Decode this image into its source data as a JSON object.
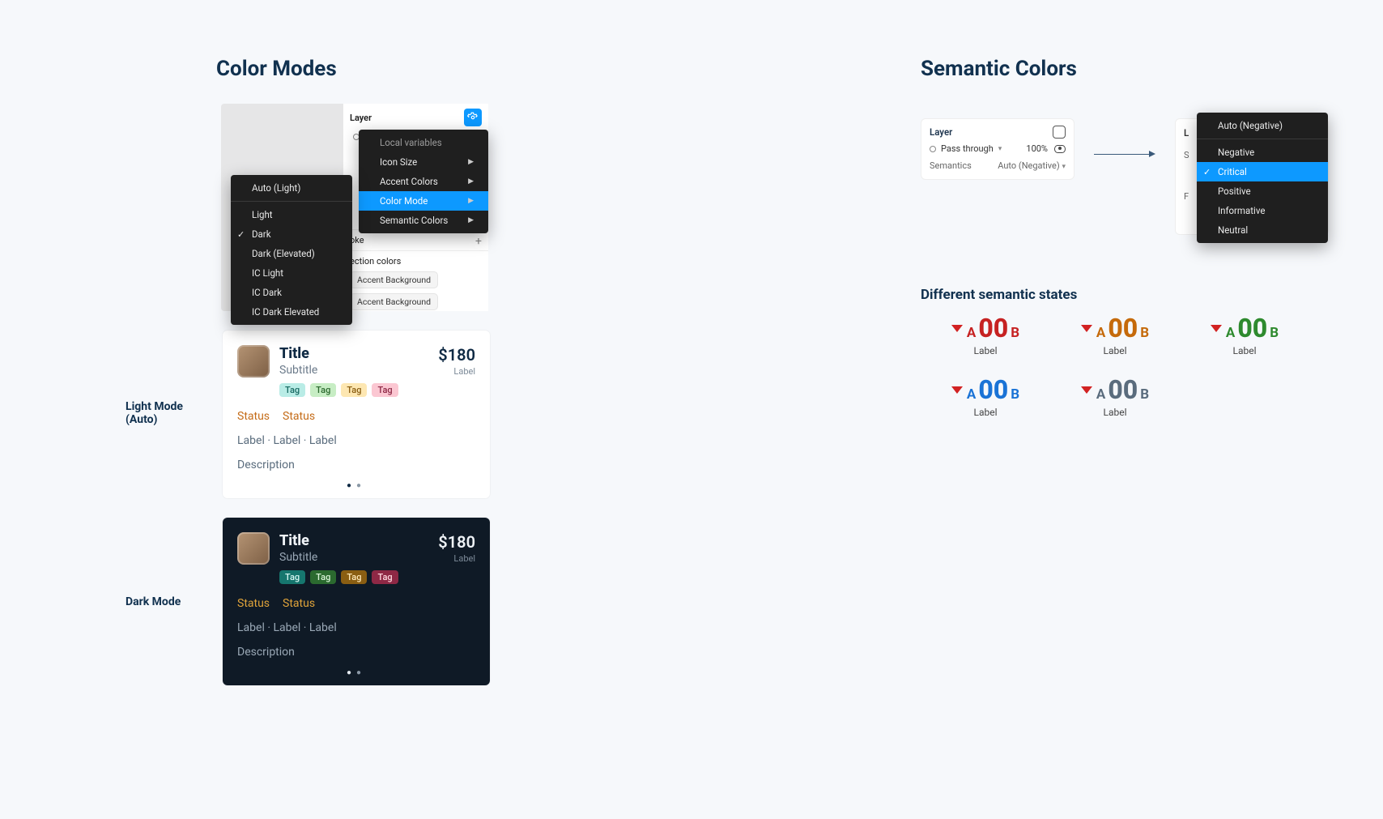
{
  "left": {
    "heading": "Color Modes",
    "figma": {
      "layerLabel": "Layer",
      "passthrough": "C",
      "strokeHeader": "oke",
      "selectionColorsHeader": "ection colors",
      "chip1": "Accent Background",
      "chip2": "Accent Background",
      "varsMenu": {
        "header": "Local variables",
        "items": [
          "Icon Size",
          "Accent Colors",
          "Color Mode",
          "Semantic Colors"
        ],
        "selectedIndex": 2
      },
      "modeMenu": {
        "auto": "Auto (Light)",
        "items": [
          "Light",
          "Dark",
          "Dark (Elevated)",
          "IC Light",
          "IC Dark",
          "IC Dark Elevated"
        ],
        "checkedIndex": 1
      }
    },
    "lightLabelA": "Light Mode",
    "lightLabelB": "(Auto)",
    "darkLabel": "Dark Mode",
    "card": {
      "title": "Title",
      "subtitle": "Subtitle",
      "price": "$180",
      "priceLabel": "Label",
      "tags": [
        "Tag",
        "Tag",
        "Tag",
        "Tag"
      ],
      "status1": "Status",
      "status2": "Status",
      "labelsLine": "Label · Label · Label",
      "description": "Description"
    }
  },
  "right": {
    "heading": "Semantic Colors",
    "panel": {
      "layerLabel": "Layer",
      "passthrough": "Pass through",
      "opacity": "100%",
      "semanticsLabel": "Semantics",
      "semanticsValue": "Auto (Negative)"
    },
    "rightGhostLabel": "L",
    "rightGhostSub": "S",
    "rightGhostFooter": "F",
    "dropdown": {
      "auto": "Auto (Negative)",
      "items": [
        "Negative",
        "Critical",
        "Positive",
        "Informative",
        "Neutral"
      ],
      "checkedIndex": 1
    },
    "statesHeading": "Different semantic states",
    "state": {
      "A": "A",
      "digits": "00",
      "B": "B",
      "label": "Label"
    }
  }
}
